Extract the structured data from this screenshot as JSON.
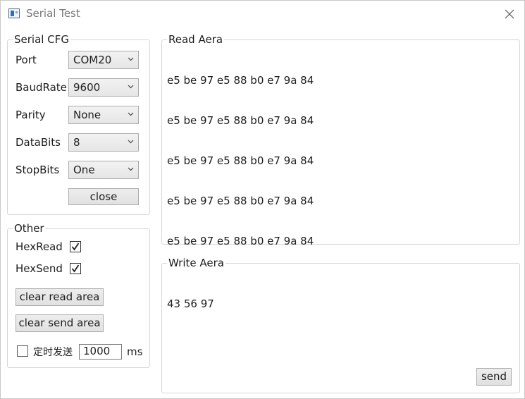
{
  "window": {
    "title": "Serial Test"
  },
  "serial_cfg": {
    "legend": "Serial CFG",
    "port": {
      "label": "Port",
      "value": "COM20"
    },
    "baudrate": {
      "label": "BaudRate",
      "value": "9600"
    },
    "parity": {
      "label": "Parity",
      "value": "None"
    },
    "databits": {
      "label": "DataBits",
      "value": "8"
    },
    "stopbits": {
      "label": "StopBits",
      "value": "One"
    },
    "close_button": "close"
  },
  "other": {
    "legend": "Other",
    "hexread": {
      "label": "HexRead",
      "checked": true
    },
    "hexsend": {
      "label": "HexSend",
      "checked": true
    },
    "clear_read_button": "clear read area",
    "clear_send_button": "clear send area",
    "timed_send": {
      "label": "定时发送",
      "checked": false,
      "interval": "1000",
      "unit": "ms"
    }
  },
  "read_area": {
    "legend": "Read Aera",
    "lines": [
      "e5 be 97 e5 88 b0 e7 9a 84",
      "e5 be 97 e5 88 b0 e7 9a 84",
      "e5 be 97 e5 88 b0 e7 9a 84",
      "e5 be 97 e5 88 b0 e7 9a 84",
      "e5 be 97 e5 88 b0 e7 9a 84"
    ]
  },
  "write_area": {
    "legend": "Write Aera",
    "text": "43 56 97",
    "send_button": "send"
  }
}
